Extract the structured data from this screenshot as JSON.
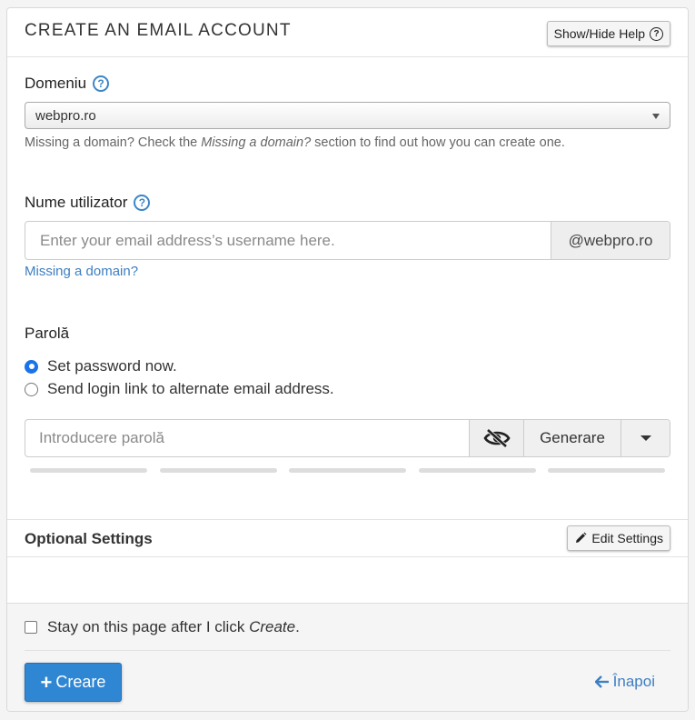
{
  "header": {
    "title": "CREATE AN EMAIL ACCOUNT",
    "help_button": "Show/Hide Help"
  },
  "domain": {
    "label": "Domeniu",
    "selected": "webpro.ro",
    "help_prefix": "Missing a domain? Check the ",
    "help_emphasis": "Missing a domain?",
    "help_suffix": " section to find out how you can create one."
  },
  "username": {
    "label": "Nume utilizator",
    "placeholder": "Enter your email address’s username here.",
    "domain_suffix": "@webpro.ro",
    "link": "Missing a domain?"
  },
  "password": {
    "label": "Parolă",
    "options": [
      {
        "label": "Set password now.",
        "checked": true
      },
      {
        "label": "Send login link to alternate email address.",
        "checked": false
      }
    ],
    "placeholder": "Introducere parolă",
    "generate_label": "Generare",
    "strength_segments": 5
  },
  "optional": {
    "title": "Optional Settings",
    "edit_button": "Edit Settings"
  },
  "footer": {
    "stay_prefix": "Stay on this page after I click ",
    "stay_emphasis": "Create",
    "stay_suffix": ".",
    "stay_checked": false,
    "create_label": "Creare",
    "back_label": "Înapoi"
  },
  "colors": {
    "primary": "#2f87d3",
    "link": "#3d7fc1",
    "radio_checked": "#1a73e8"
  }
}
